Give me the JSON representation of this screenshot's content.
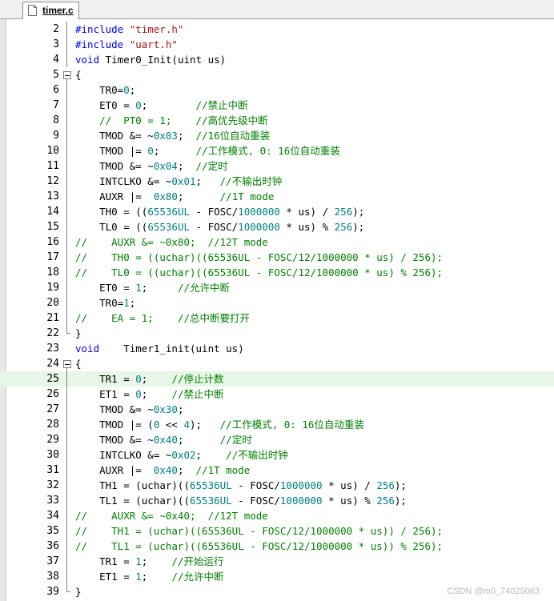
{
  "tab": {
    "label": "timer.c"
  },
  "watermark": "CSDN @m0_74025063",
  "colors": {
    "keyword": "#0000ff",
    "string": "#a31515",
    "number": "#008080",
    "comment": "#008000",
    "current_line": "#e8f6e8"
  },
  "lines": [
    {
      "no": "2",
      "fold": "line",
      "tokens": [
        [
          "pp",
          "#include "
        ],
        [
          "str",
          "\"timer.h\""
        ]
      ]
    },
    {
      "no": "3",
      "fold": "line",
      "tokens": [
        [
          "pp",
          "#include "
        ],
        [
          "str",
          "\"uart.h\""
        ]
      ]
    },
    {
      "no": "4",
      "fold": "line",
      "tokens": [
        [
          "kw",
          "void"
        ],
        [
          "t",
          " Timer0_Init(uint us)"
        ]
      ]
    },
    {
      "no": "5",
      "fold": "open",
      "tokens": [
        [
          "t",
          "{"
        ]
      ]
    },
    {
      "no": "6",
      "fold": "line",
      "tokens": [
        [
          "t",
          "    TR0="
        ],
        [
          "num",
          "0"
        ],
        [
          "t",
          ";"
        ]
      ]
    },
    {
      "no": "7",
      "fold": "line",
      "tokens": [
        [
          "t",
          "    ET0 = "
        ],
        [
          "num",
          "0"
        ],
        [
          "t",
          ";        "
        ],
        [
          "cm",
          "//禁止中断"
        ]
      ]
    },
    {
      "no": "8",
      "fold": "line",
      "tokens": [
        [
          "t",
          "    "
        ],
        [
          "cm",
          "//  PT0 = 1;    //高优先级中断"
        ]
      ]
    },
    {
      "no": "9",
      "fold": "line",
      "tokens": [
        [
          "t",
          "    TMOD &= ~"
        ],
        [
          "num",
          "0x03"
        ],
        [
          "t",
          ";  "
        ],
        [
          "cm",
          "//16位自动重装"
        ]
      ]
    },
    {
      "no": "10",
      "fold": "line",
      "tokens": [
        [
          "t",
          "    TMOD |= "
        ],
        [
          "num",
          "0"
        ],
        [
          "t",
          ";      "
        ],
        [
          "cm",
          "//工作模式, 0: 16位自动重装"
        ]
      ]
    },
    {
      "no": "11",
      "fold": "line",
      "tokens": [
        [
          "t",
          "    TMOD &= ~"
        ],
        [
          "num",
          "0x04"
        ],
        [
          "t",
          ";  "
        ],
        [
          "cm",
          "//定时"
        ]
      ]
    },
    {
      "no": "12",
      "fold": "line",
      "tokens": [
        [
          "t",
          "    INTCLKO &= ~"
        ],
        [
          "num",
          "0x01"
        ],
        [
          "t",
          ";   "
        ],
        [
          "cm",
          "//不输出时钟"
        ]
      ]
    },
    {
      "no": "13",
      "fold": "line",
      "tokens": [
        [
          "t",
          "    AUXR |=  "
        ],
        [
          "num",
          "0x80"
        ],
        [
          "t",
          ";      "
        ],
        [
          "cm",
          "//1T mode"
        ]
      ]
    },
    {
      "no": "14",
      "fold": "line",
      "tokens": [
        [
          "t",
          "    TH0 = (("
        ],
        [
          "num",
          "65536UL"
        ],
        [
          "t",
          " - FOSC/"
        ],
        [
          "num",
          "1000000"
        ],
        [
          "t",
          " * us) / "
        ],
        [
          "num",
          "256"
        ],
        [
          "t",
          ");"
        ]
      ]
    },
    {
      "no": "15",
      "fold": "line",
      "tokens": [
        [
          "t",
          "    TL0 = (("
        ],
        [
          "num",
          "65536UL"
        ],
        [
          "t",
          " - FOSC/"
        ],
        [
          "num",
          "1000000"
        ],
        [
          "t",
          " * us) % "
        ],
        [
          "num",
          "256"
        ],
        [
          "t",
          ");"
        ]
      ]
    },
    {
      "no": "16",
      "fold": "line",
      "tokens": [
        [
          "cm",
          "//    AUXR &= ~0x80;  //12T mode"
        ]
      ]
    },
    {
      "no": "17",
      "fold": "line",
      "tokens": [
        [
          "cm",
          "//    TH0 = ((uchar)((65536UL - FOSC/12/1000000 * us) / 256);"
        ]
      ]
    },
    {
      "no": "18",
      "fold": "line",
      "tokens": [
        [
          "cm",
          "//    TL0 = ((uchar)((65536UL - FOSC/12/1000000 * us) % 256);"
        ]
      ]
    },
    {
      "no": "19",
      "fold": "line",
      "tokens": [
        [
          "t",
          "    ET0 = "
        ],
        [
          "num",
          "1"
        ],
        [
          "t",
          ";     "
        ],
        [
          "cm",
          "//允许中断"
        ]
      ]
    },
    {
      "no": "20",
      "fold": "line",
      "tokens": [
        [
          "t",
          "    TR0="
        ],
        [
          "num",
          "1"
        ],
        [
          "t",
          ";"
        ]
      ]
    },
    {
      "no": "21",
      "fold": "line",
      "tokens": [
        [
          "cm",
          "//    EA = 1;    //总中断要打开"
        ]
      ]
    },
    {
      "no": "22",
      "fold": "end",
      "tokens": [
        [
          "t",
          "}"
        ]
      ]
    },
    {
      "no": "23",
      "fold": "none",
      "tokens": [
        [
          "kw",
          "void"
        ],
        [
          "t",
          "    Timer1_init(uint us)"
        ]
      ]
    },
    {
      "no": "24",
      "fold": "open",
      "tokens": [
        [
          "t",
          "{"
        ]
      ]
    },
    {
      "no": "25",
      "fold": "line",
      "current": true,
      "tokens": [
        [
          "t",
          "    TR1 = "
        ],
        [
          "num",
          "0"
        ],
        [
          "t",
          ";    "
        ],
        [
          "cm",
          "//停止计数"
        ]
      ]
    },
    {
      "no": "26",
      "fold": "line",
      "tokens": [
        [
          "t",
          "    ET1 = "
        ],
        [
          "num",
          "0"
        ],
        [
          "t",
          ";    "
        ],
        [
          "cm",
          "//禁止中断"
        ]
      ]
    },
    {
      "no": "27",
      "fold": "line",
      "tokens": [
        [
          "t",
          "    TMOD &= ~"
        ],
        [
          "num",
          "0x30"
        ],
        [
          "t",
          ";"
        ]
      ]
    },
    {
      "no": "28",
      "fold": "line",
      "tokens": [
        [
          "t",
          "    TMOD |= ("
        ],
        [
          "num",
          "0"
        ],
        [
          "t",
          " << "
        ],
        [
          "num",
          "4"
        ],
        [
          "t",
          ");   "
        ],
        [
          "cm",
          "//工作模式, 0: 16位自动重装"
        ]
      ]
    },
    {
      "no": "29",
      "fold": "line",
      "tokens": [
        [
          "t",
          "    TMOD &= ~"
        ],
        [
          "num",
          "0x40"
        ],
        [
          "t",
          ";      "
        ],
        [
          "cm",
          "//定时"
        ]
      ]
    },
    {
      "no": "30",
      "fold": "line",
      "tokens": [
        [
          "t",
          "    INTCLKO &= ~"
        ],
        [
          "num",
          "0x02"
        ],
        [
          "t",
          ";    "
        ],
        [
          "cm",
          "//不输出时钟"
        ]
      ]
    },
    {
      "no": "31",
      "fold": "line",
      "tokens": [
        [
          "t",
          "    AUXR |=  "
        ],
        [
          "num",
          "0x40"
        ],
        [
          "t",
          ";  "
        ],
        [
          "cm",
          "//1T mode"
        ]
      ]
    },
    {
      "no": "32",
      "fold": "line",
      "tokens": [
        [
          "t",
          "    TH1 = (uchar)(("
        ],
        [
          "num",
          "65536UL"
        ],
        [
          "t",
          " - FOSC/"
        ],
        [
          "num",
          "1000000"
        ],
        [
          "t",
          " * us) / "
        ],
        [
          "num",
          "256"
        ],
        [
          "t",
          ");"
        ]
      ]
    },
    {
      "no": "33",
      "fold": "line",
      "tokens": [
        [
          "t",
          "    TL1 = (uchar)(("
        ],
        [
          "num",
          "65536UL"
        ],
        [
          "t",
          " - FOSC/"
        ],
        [
          "num",
          "1000000"
        ],
        [
          "t",
          " * us) % "
        ],
        [
          "num",
          "256"
        ],
        [
          "t",
          ");"
        ]
      ]
    },
    {
      "no": "34",
      "fold": "line",
      "tokens": [
        [
          "cm",
          "//    AUXR &= ~0x40;  //12T mode"
        ]
      ]
    },
    {
      "no": "35",
      "fold": "line",
      "tokens": [
        [
          "cm",
          "//    TH1 = (uchar)((65536UL - FOSC/12/1000000 * us)) / 256);"
        ]
      ]
    },
    {
      "no": "36",
      "fold": "line",
      "tokens": [
        [
          "cm",
          "//    TL1 = (uchar)((65536UL - FOSC/12/1000000 * us)) % 256);"
        ]
      ]
    },
    {
      "no": "37",
      "fold": "line",
      "tokens": [
        [
          "t",
          "    TR1 = "
        ],
        [
          "num",
          "1"
        ],
        [
          "t",
          ";    "
        ],
        [
          "cm",
          "//开始运行"
        ]
      ]
    },
    {
      "no": "38",
      "fold": "line",
      "tokens": [
        [
          "t",
          "    ET1 = "
        ],
        [
          "num",
          "1"
        ],
        [
          "t",
          ";    "
        ],
        [
          "cm",
          "//允许中断"
        ]
      ]
    },
    {
      "no": "39",
      "fold": "end",
      "tokens": [
        [
          "t",
          "}"
        ]
      ]
    }
  ]
}
